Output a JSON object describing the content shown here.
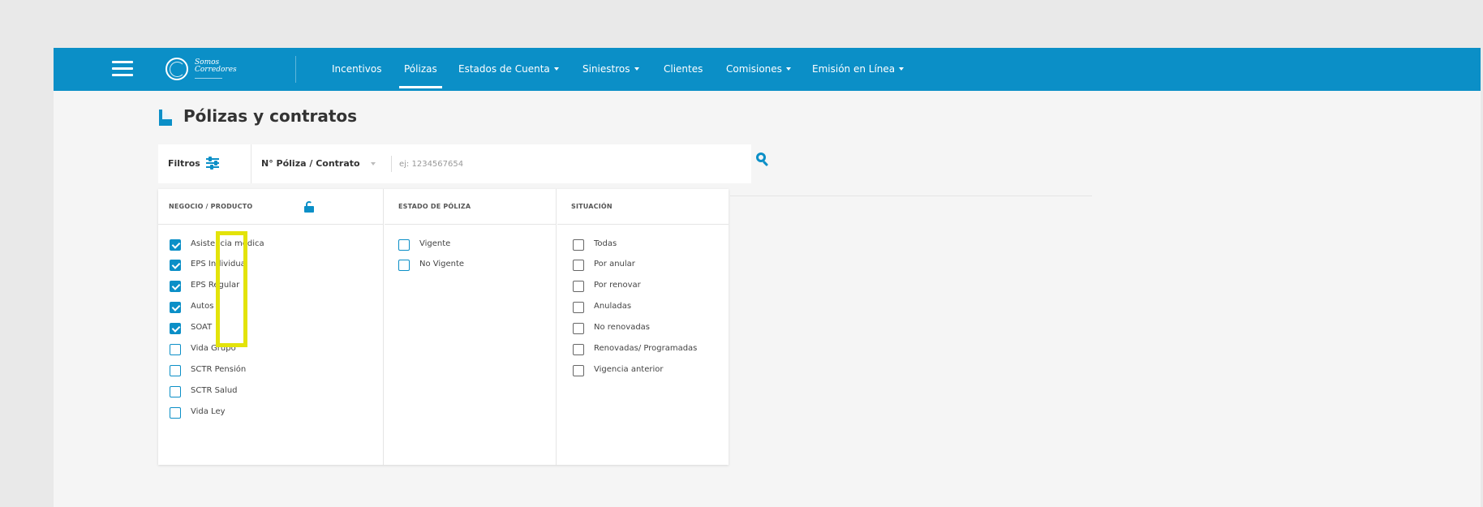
{
  "header": {
    "logo_text_line1": "Somos",
    "logo_text_line2": "Corredores",
    "nav": [
      {
        "label": "Incentivos",
        "active": false,
        "dropdown": false
      },
      {
        "label": "Pólizas",
        "active": true,
        "dropdown": false
      },
      {
        "label": "Estados de Cuenta",
        "active": false,
        "dropdown": true
      },
      {
        "label": "Siniestros",
        "active": false,
        "dropdown": true
      },
      {
        "label": "Clientes",
        "active": false,
        "dropdown": false
      },
      {
        "label": "Comisiones",
        "active": false,
        "dropdown": true
      },
      {
        "label": "Emisión en Línea",
        "active": false,
        "dropdown": true
      }
    ]
  },
  "page": {
    "title": "Pólizas y contratos"
  },
  "search": {
    "filters_label": "Filtros",
    "type_label": "N° Póliza / Contrato",
    "placeholder": "ej: 1234567654"
  },
  "filters": {
    "negocio": {
      "title": "NEGOCIO / PRODUCTO",
      "items": [
        {
          "label": "Asistencia médica",
          "checked": true
        },
        {
          "label": "EPS Individual",
          "checked": true
        },
        {
          "label": "EPS Regular",
          "checked": true
        },
        {
          "label": "Autos",
          "checked": true
        },
        {
          "label": "SOAT",
          "checked": true
        },
        {
          "label": "Vida Grupo",
          "checked": false
        },
        {
          "label": "SCTR Pensión",
          "checked": false
        },
        {
          "label": "SCTR Salud",
          "checked": false
        },
        {
          "label": "Vida Ley",
          "checked": false
        }
      ]
    },
    "estado": {
      "title": "ESTADO DE PÓLIZA",
      "items": [
        {
          "label": "Vigente",
          "checked": false
        },
        {
          "label": "No Vigente",
          "checked": false
        }
      ]
    },
    "situacion": {
      "title": "SITUACIÓN",
      "items": [
        {
          "label": "Todas",
          "checked": false
        },
        {
          "label": "Por anular",
          "checked": false
        },
        {
          "label": "Por renovar",
          "checked": false
        },
        {
          "label": "Anuladas",
          "checked": false
        },
        {
          "label": "No renovadas",
          "checked": false
        },
        {
          "label": "Renovadas/ Programadas",
          "checked": false
        },
        {
          "label": "Vigencia anterior",
          "checked": false
        }
      ]
    }
  },
  "colors": {
    "primary": "#0b8fc7",
    "highlight": "#e3e30a",
    "background": "#f5f5f5"
  }
}
